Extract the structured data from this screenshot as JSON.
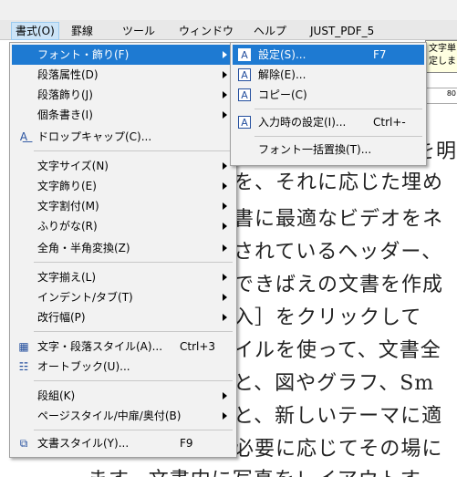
{
  "menubar": {
    "items": [
      "書式(O)",
      "罫線",
      "ツール",
      "ウィンドウ",
      "ヘルプ",
      "JUST_PDF_5"
    ]
  },
  "document": {
    "lines": [
      "を明",
      "を、それに応じた埋め",
      "書に最適なビデオをネ",
      "されているヘッダー、",
      "できばえの文書を作成",
      "入］をクリックして",
      "イルを使って、文書全",
      "と、図やグラフ、Sm",
      "と、新しいテーマに適",
      "必要に応じてその場に",
      "ます。文書内に写真をレイアウトす"
    ],
    "tooltip": [
      "文字単",
      "定しま"
    ],
    "ruler_mark": "80"
  },
  "main_menu": {
    "items": [
      {
        "label": "フォント・飾り(F)",
        "arrow": true,
        "highlight": true,
        "icon": ""
      },
      {
        "label": "段落属性(D)",
        "arrow": true
      },
      {
        "label": "段落飾り(J)",
        "arrow": true
      },
      {
        "label": "個条書き(I)",
        "arrow": true
      },
      {
        "label": "ドロップキャップ(C)...",
        "icon": "drop-cap-icon"
      },
      {
        "label": "文字サイズ(N)",
        "arrow": true
      },
      {
        "label": "文字飾り(E)",
        "arrow": true
      },
      {
        "label": "文字割付(M)",
        "arrow": true
      },
      {
        "label": "ふりがな(R)",
        "arrow": true
      },
      {
        "label": "全角・半角変換(Z)",
        "arrow": true
      },
      {
        "label": "文字揃え(L)",
        "arrow": true
      },
      {
        "label": "インデント/タブ(T)",
        "arrow": true
      },
      {
        "label": "改行幅(P)",
        "arrow": true
      },
      {
        "label": "文字・段落スタイル(A)...",
        "shortcut": "Ctrl+3",
        "icon": "style-icon"
      },
      {
        "label": "オートブック(U)...",
        "icon": "autobook-icon"
      },
      {
        "label": "段組(K)",
        "arrow": true
      },
      {
        "label": "ページスタイル/中扉/奥付(B)",
        "arrow": true
      },
      {
        "label": "文書スタイル(Y)...",
        "shortcut": "F9",
        "icon": "doc-style-icon"
      }
    ]
  },
  "sub_menu": {
    "items": [
      {
        "label": "設定(S)...",
        "shortcut": "F7",
        "highlight": true,
        "icon": "A"
      },
      {
        "label": "解除(E)...",
        "icon": "A"
      },
      {
        "label": "コピー(C)",
        "icon": "A"
      },
      {
        "label": "入力時の設定(I)...",
        "shortcut": "Ctrl+-",
        "icon": "A"
      },
      {
        "label": "フォント一括置換(T)..."
      }
    ]
  },
  "colors": {
    "highlight": "#1e7ad2",
    "menu_bg": "#f2f2f2"
  }
}
